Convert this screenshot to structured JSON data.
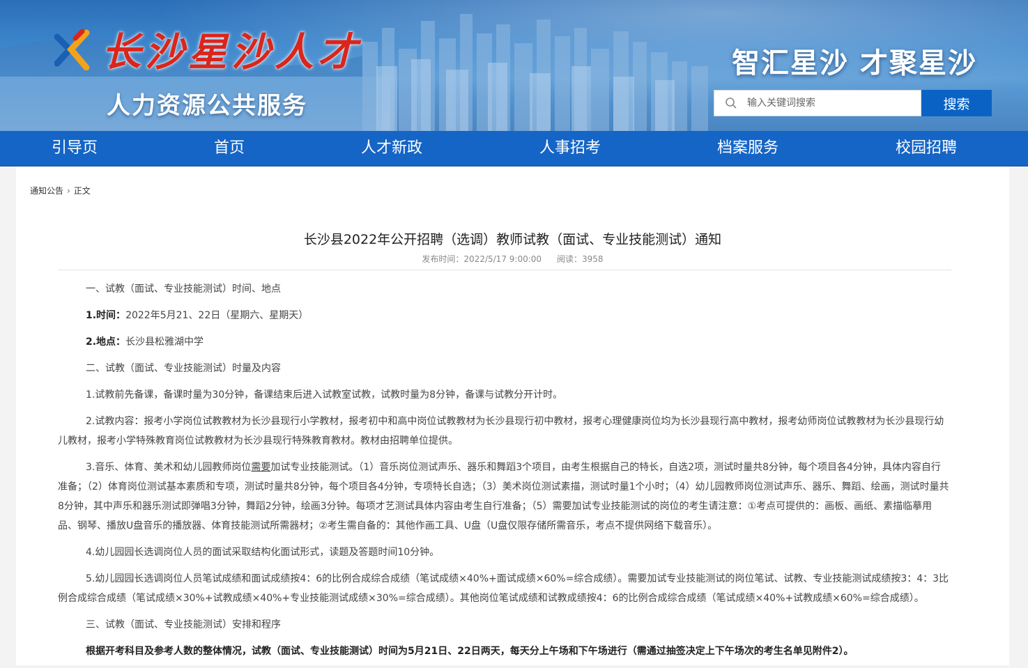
{
  "header": {
    "logo_text": "长沙星沙人才",
    "subtitle": "人力资源公共服务",
    "slogan": "智汇星沙 才聚星沙",
    "search_placeholder": "输入关键词搜索",
    "search_button": "搜索"
  },
  "nav": [
    "引导页",
    "首页",
    "人才新政",
    "人事招考",
    "档案服务",
    "校园招聘"
  ],
  "breadcrumb": {
    "section": "通知公告",
    "current": "正文"
  },
  "article": {
    "title": "长沙县2022年公开招聘（选调）教师试教（面试、专业技能测试）通知",
    "publish_time": "发布时间：2022/5/17 9:00:00",
    "views": "阅读：3958",
    "p1": "一、试教（面试、专业技能测试）时间、地点",
    "p2_label": "1.时间：",
    "p2_text": "2022年5月21、22日（星期六、星期天）",
    "p3_label": "2.地点：",
    "p3_text": "长沙县松雅湖中学",
    "p4": "二、试教（面试、专业技能测试）时量及内容",
    "p5": "1.试教前先备课，备课时量为30分钟，备课结束后进入试教室试教，试教时量为8分钟，备课与试教分开计时。",
    "p6": "2.试教内容：报考小学岗位试教教材为长沙县现行小学教材，报考初中和高中岗位试教教材为长沙县现行初中教材，报考心理健康岗位均为长沙县现行高中教材，报考幼师岗位试教教材为长沙县现行幼儿教材，报考小学特殊教育岗位试教教材为长沙县现行特殊教育教材。教材由招聘单位提供。",
    "p7_a": "3.音乐、体育、美术和幼儿园教师岗位",
    "p7_u": "需要",
    "p7_b": "加试专业技能测试。（1）音乐岗位测试声乐、器乐和舞蹈3个项目，由考生根据自己的特长，自选2项，测试时量共8分钟，每个项目各4分钟，具体内容自行准备；（2）体育岗位测试基本素质和专项，测试时量共8分钟，每个项目各4分钟，专项特长自选；（3）美术岗位测试素描，测试时量1个小时；（4）幼儿园教师岗位测试声乐、器乐、舞蹈、绘画，测试时量共8分钟，其中声乐和器乐测试即弹唱3分钟，舞蹈2分钟，绘画3分钟。每项才艺测试具体内容由考生自行准备；（5）需要加试专业技能测试的岗位的考生请注意：①考点可提供的：画板、画纸、素描临摹用品、钢琴、播放U盘音乐的播放器、体育技能测试所需器材；②考生需自备的：其他作画工具、U盘（U盘仅限存储所需音乐，考点不提供网络下载音乐）。",
    "p8": "4.幼儿园园长选调岗位人员的面试采取结构化面试形式，读题及答题时间10分钟。",
    "p9": "5.幼儿园园长选调岗位人员笔试成绩和面试成绩按4：6的比例合成综合成绩（笔试成绩×40%+面试成绩×60%=综合成绩）。需要加试专业技能测试的岗位笔试、试教、专业技能测试成绩按3：4：3比例合成综合成绩（笔试成绩×30%+试教成绩×40%+专业技能测试成绩×30%=综合成绩）。其他岗位笔试成绩和试教成绩按4：6的比例合成综合成绩（笔试成绩×40%+试教成绩×60%=综合成绩）。",
    "p10": "三、试教（面试、专业技能测试）安排和程序",
    "p11": "根据开考科目及参考人数的整体情况，试教（面试、专业技能测试）时间为5月21日、22日两天，每天分上午场和下午场进行（需通过抽签决定上下午场次的考生名单见附件2）。"
  },
  "colors": {
    "nav": "#1565c6",
    "search_button": "#0a63c4",
    "logo_red": "#d9261c"
  }
}
